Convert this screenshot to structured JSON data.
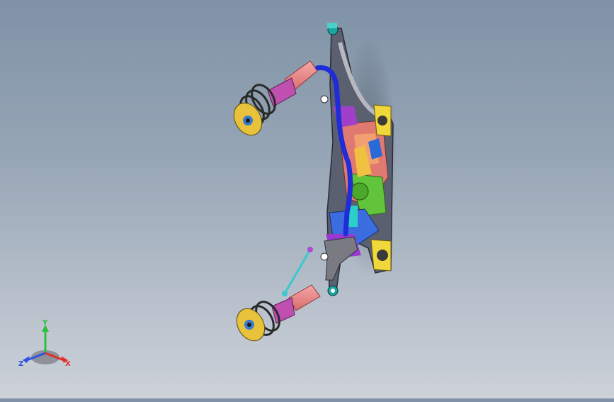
{
  "viewport": {
    "background_top": "#7f92a6",
    "background_bottom": "#cdd2d9",
    "model": {
      "parts": [
        "strut-assembly-upper",
        "strut-assembly-lower",
        "subframe",
        "stabilizer-bar",
        "stabilizer-link",
        "control-arm",
        "steering-rack"
      ]
    }
  },
  "triad": {
    "x_label": "X",
    "y_label": "Y",
    "z_label": "Z",
    "x_color": "#e0302a",
    "y_color": "#2fbf3a",
    "z_color": "#3050e0"
  }
}
